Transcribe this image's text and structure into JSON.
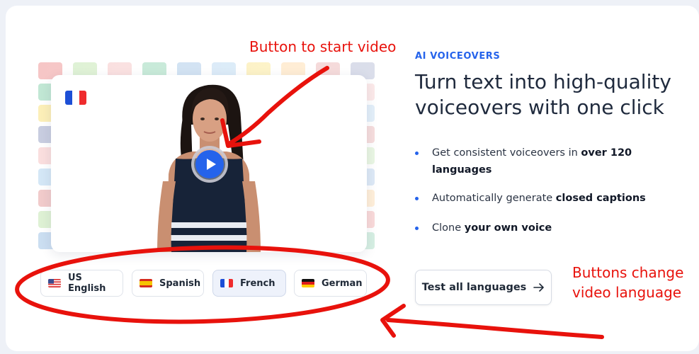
{
  "video": {
    "selected_flag": "france-flag",
    "play_icon": "play-icon"
  },
  "languages": [
    {
      "label": "US English",
      "flag": "us-flag"
    },
    {
      "label": "Spanish",
      "flag": "spain-flag"
    },
    {
      "label": "French",
      "flag": "france-flag",
      "active": true
    },
    {
      "label": "German",
      "flag": "germany-flag"
    }
  ],
  "content": {
    "eyebrow": "AI VOICEOVERS",
    "headline_line1": "Turn text into high-quality",
    "headline_line2": "voiceovers with one click",
    "bullets": [
      {
        "pre": "Get consistent voiceovers in ",
        "strong": "over 120 languages",
        "post": ""
      },
      {
        "pre": "Automatically generate ",
        "strong": "closed captions",
        "post": ""
      },
      {
        "pre": "Clone ",
        "strong": "your own voice",
        "post": ""
      }
    ],
    "cta_label": "Test all languages",
    "cta_icon": "arrow-right-icon"
  },
  "annotations": {
    "play_note": "Button to start video",
    "lang_note_line1": "Buttons change",
    "lang_note_line2": "video language"
  },
  "colors": {
    "accent": "#2563eb",
    "annotation": "#e8120c",
    "text_dark": "#1f2a3d"
  }
}
